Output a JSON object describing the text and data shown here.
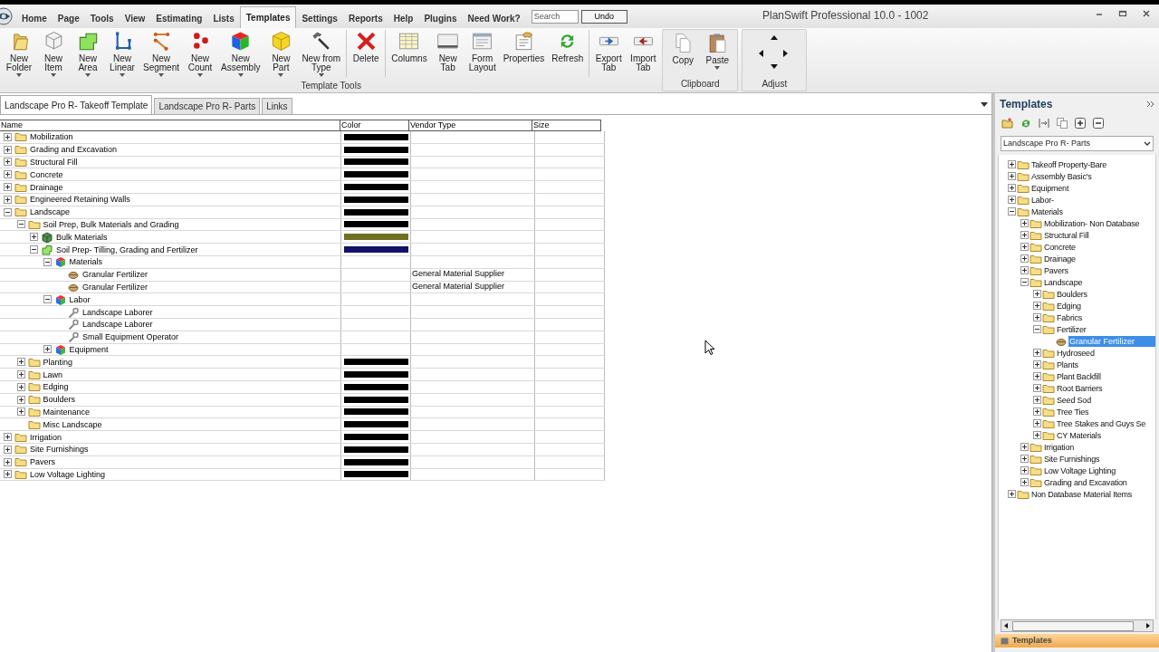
{
  "window": {
    "title": "PlanSwift Professional 10.0 - 1002"
  },
  "menu_tabs": [
    {
      "label": "Home",
      "selected": false
    },
    {
      "label": "Page",
      "selected": false
    },
    {
      "label": "Tools",
      "selected": false
    },
    {
      "label": "View",
      "selected": false
    },
    {
      "label": "Estimating",
      "selected": false
    },
    {
      "label": "Lists",
      "selected": false
    },
    {
      "label": "Templates",
      "selected": true
    },
    {
      "label": "Settings",
      "selected": false
    },
    {
      "label": "Reports",
      "selected": false
    },
    {
      "label": "Help",
      "selected": false
    },
    {
      "label": "Plugins",
      "selected": false
    },
    {
      "label": "Need Work?",
      "selected": false
    }
  ],
  "search": {
    "placeholder": "Search"
  },
  "undo_button": "Undo",
  "ribbon": {
    "groups": [
      {
        "label": "Template Tools",
        "buttons": [
          {
            "label": "New\nFolder",
            "dropdown": true
          },
          {
            "label": "New\nItem",
            "dropdown": true
          },
          {
            "label": "New\nArea",
            "dropdown": true
          },
          {
            "label": "New\nLinear",
            "dropdown": true
          },
          {
            "label": "New\nSegment",
            "dropdown": true
          },
          {
            "label": "New\nCount",
            "dropdown": true
          },
          {
            "label": "New\nAssembly",
            "dropdown": true
          },
          {
            "label": "New\nPart",
            "dropdown": true
          },
          {
            "label": "New from\nType",
            "dropdown": true
          },
          {
            "label": "Delete",
            "dropdown": false
          },
          {
            "label": "Columns",
            "dropdown": false
          },
          {
            "label": "New\nTab",
            "dropdown": false
          },
          {
            "label": "Form\nLayout",
            "dropdown": false
          },
          {
            "label": "Properties",
            "dropdown": false
          },
          {
            "label": "Refresh",
            "dropdown": false
          },
          {
            "label": "Export\nTab",
            "dropdown": false
          },
          {
            "label": "Import\nTab",
            "dropdown": false
          }
        ]
      },
      {
        "label": "Clipboard",
        "buttons": [
          {
            "label": "Copy",
            "dropdown": false
          },
          {
            "label": "Paste",
            "dropdown": true
          }
        ]
      },
      {
        "label": "Adjust"
      }
    ]
  },
  "document_tabs": [
    {
      "label": "Landscape Pro R- Takeoff Template",
      "selected": true
    },
    {
      "label": "Landscape Pro R- Parts",
      "selected": false
    },
    {
      "label": "Links",
      "selected": false
    }
  ],
  "table": {
    "columns": [
      "Name",
      "Color",
      "Vendor Type",
      "Size"
    ],
    "rows": [
      {
        "name": "Mobilization",
        "kind": "folder",
        "expanded": false,
        "color": "#000000"
      },
      {
        "name": "Grading and Excavation",
        "kind": "folder",
        "expanded": false,
        "color": "#000000"
      },
      {
        "name": "Structural Fill",
        "kind": "folder",
        "expanded": false,
        "color": "#000000"
      },
      {
        "name": "Concrete",
        "kind": "folder",
        "expanded": false,
        "color": "#000000"
      },
      {
        "name": "Drainage",
        "kind": "folder",
        "expanded": false,
        "color": "#000000"
      },
      {
        "name": "Engineered Retaining Walls",
        "kind": "folder",
        "expanded": false,
        "color": "#000000"
      },
      {
        "name": "Landscape",
        "kind": "folder",
        "expanded": true,
        "color": "#000000",
        "children": [
          {
            "name": "Soil Prep, Bulk Materials and Grading",
            "kind": "folder",
            "expanded": true,
            "color": "#000000",
            "children": [
              {
                "name": "Bulk Materials",
                "kind": "item",
                "expanded": false,
                "color": "#707022"
              },
              {
                "name": "Soil Prep- Tilling, Grading and Fertilizer",
                "kind": "area",
                "expanded": true,
                "color": "#12126a",
                "children": [
                  {
                    "name": "Materials",
                    "kind": "assembly",
                    "expanded": true,
                    "children": [
                      {
                        "name": "Granular Fertilizer",
                        "kind": "part",
                        "vendor_type": "General Material Supplier"
                      },
                      {
                        "name": "Granular Fertilizer",
                        "kind": "part",
                        "vendor_type": "General Material Supplier"
                      }
                    ]
                  },
                  {
                    "name": "Labor",
                    "kind": "assembly",
                    "expanded": true,
                    "children": [
                      {
                        "name": "Landscape Laborer",
                        "kind": "labor"
                      },
                      {
                        "name": "Landscape Laborer",
                        "kind": "labor"
                      },
                      {
                        "name": "Small Equipment Operator",
                        "kind": "labor"
                      }
                    ]
                  },
                  {
                    "name": "Equipment",
                    "kind": "assembly",
                    "expanded": false
                  }
                ]
              }
            ]
          },
          {
            "name": "Planting",
            "kind": "folder",
            "expanded": false,
            "color": "#000000"
          },
          {
            "name": "Lawn",
            "kind": "folder",
            "expanded": false,
            "color": "#000000"
          },
          {
            "name": "Edging",
            "kind": "folder",
            "expanded": false,
            "color": "#000000"
          },
          {
            "name": "Boulders",
            "kind": "folder",
            "expanded": false,
            "color": "#000000"
          },
          {
            "name": "Maintenance",
            "kind": "folder",
            "expanded": false,
            "color": "#000000"
          },
          {
            "name": "Misc Landscape",
            "kind": "folder",
            "color": "#000000"
          }
        ]
      },
      {
        "name": "Irrigation",
        "kind": "folder",
        "expanded": false,
        "color": "#000000"
      },
      {
        "name": "Site Furnishings",
        "kind": "folder",
        "expanded": false,
        "color": "#000000"
      },
      {
        "name": "Pavers",
        "kind": "folder",
        "expanded": false,
        "color": "#000000"
      },
      {
        "name": "Low Voltage Lighting",
        "kind": "folder",
        "expanded": false,
        "color": "#000000"
      }
    ]
  },
  "templates_panel": {
    "title": "Templates",
    "library": "Landscape Pro R- Parts",
    "bottom_tab": "Templates",
    "tree": [
      {
        "name": "Takeoff Property-Bare",
        "kind": "folder",
        "expanded": false,
        "selected": false
      },
      {
        "name": "Assembly Basic's",
        "kind": "folder",
        "expanded": false,
        "selected": false
      },
      {
        "name": "Equipment",
        "kind": "folder",
        "expanded": false,
        "selected": false
      },
      {
        "name": "Labor-",
        "kind": "folder",
        "expanded": false,
        "selected": false
      },
      {
        "name": "Materials",
        "kind": "folder",
        "expanded": true,
        "selected": false,
        "children": [
          {
            "name": "Mobilization- Non Database",
            "kind": "folder",
            "expanded": false,
            "selected": false
          },
          {
            "name": "Structural Fill",
            "kind": "folder",
            "expanded": false,
            "selected": false
          },
          {
            "name": "Concrete",
            "kind": "folder",
            "expanded": false,
            "selected": false
          },
          {
            "name": "Drainage",
            "kind": "folder",
            "expanded": false,
            "selected": false
          },
          {
            "name": "Pavers",
            "kind": "folder",
            "expanded": false,
            "selected": false
          },
          {
            "name": "Landscape",
            "kind": "folder",
            "expanded": true,
            "selected": false,
            "children": [
              {
                "name": "Boulders",
                "kind": "folder",
                "expanded": false,
                "selected": false
              },
              {
                "name": "Edging",
                "kind": "folder",
                "expanded": false,
                "selected": false
              },
              {
                "name": "Fabrics",
                "kind": "folder",
                "expanded": false,
                "selected": false
              },
              {
                "name": "Fertilizer",
                "kind": "folder",
                "expanded": true,
                "selected": false,
                "children": [
                  {
                    "name": "Granular Fertilizer",
                    "kind": "part",
                    "selected": true
                  }
                ]
              },
              {
                "name": "Hydroseed",
                "kind": "folder",
                "expanded": false,
                "selected": false
              },
              {
                "name": "Plants",
                "kind": "folder",
                "expanded": false,
                "selected": false
              },
              {
                "name": "Plant Backfill",
                "kind": "folder",
                "expanded": false,
                "selected": false
              },
              {
                "name": "Root Barriers",
                "kind": "folder",
                "expanded": false,
                "selected": false
              },
              {
                "name": "Seed Sod",
                "kind": "folder",
                "expanded": false,
                "selected": false
              },
              {
                "name": "Tree Ties",
                "kind": "folder",
                "expanded": false,
                "selected": false
              },
              {
                "name": "Tree Stakes and Guys Se",
                "kind": "folder",
                "expanded": false,
                "selected": false
              },
              {
                "name": "CY Materials",
                "kind": "folder",
                "expanded": false,
                "selected": false
              }
            ]
          },
          {
            "name": "Irrigation",
            "kind": "folder",
            "expanded": false,
            "selected": false
          },
          {
            "name": "Site Furnishings",
            "kind": "folder",
            "expanded": false,
            "selected": false
          },
          {
            "name": "Low Voltage Lighting",
            "kind": "folder",
            "expanded": false,
            "selected": false
          },
          {
            "name": "Grading and Excavation",
            "kind": "folder",
            "expanded": false,
            "selected": false
          }
        ]
      },
      {
        "name": "Non Database Material Items",
        "kind": "folder",
        "expanded": false,
        "selected": false
      }
    ]
  }
}
